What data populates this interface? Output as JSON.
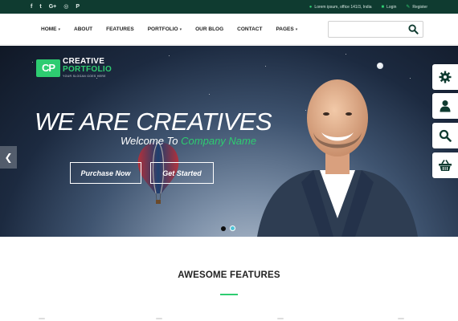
{
  "topbar": {
    "social": [
      "f",
      "t",
      "G+",
      "◎",
      "P"
    ],
    "address": "Lorem ipsum, office 141/3, India",
    "login": "Login",
    "register": "Register"
  },
  "nav": {
    "items": [
      {
        "label": "HOME",
        "dropdown": true
      },
      {
        "label": "ABOUT",
        "dropdown": false
      },
      {
        "label": "FEATURES",
        "dropdown": false
      },
      {
        "label": "PORTFOLIO",
        "dropdown": true
      },
      {
        "label": "OUR BLOG",
        "dropdown": false
      },
      {
        "label": "CONTACT",
        "dropdown": false
      },
      {
        "label": "PAGES",
        "dropdown": true
      }
    ],
    "search_placeholder": ""
  },
  "hero": {
    "logo": {
      "mark": "CP",
      "line1": "CREATIVE",
      "line2": "PORTFOLIO",
      "slogan": "YOUR SLOGAN GOES HERE"
    },
    "headline": "WE ARE CREATIVES",
    "welcome_prefix": "Welcome To ",
    "welcome_highlight": "Company Name",
    "primary_button": "Purchase Now",
    "secondary_button": "Get Started",
    "slides": 2,
    "active_slide": 2
  },
  "side_tools": [
    "gear-icon",
    "user-icon",
    "search-icon",
    "basket-icon"
  ],
  "section": {
    "title": "AWESOME FEATURES"
  },
  "colors": {
    "topbar": "#0f3b30",
    "accent": "#2ecc71",
    "nav_text": "#222222"
  }
}
